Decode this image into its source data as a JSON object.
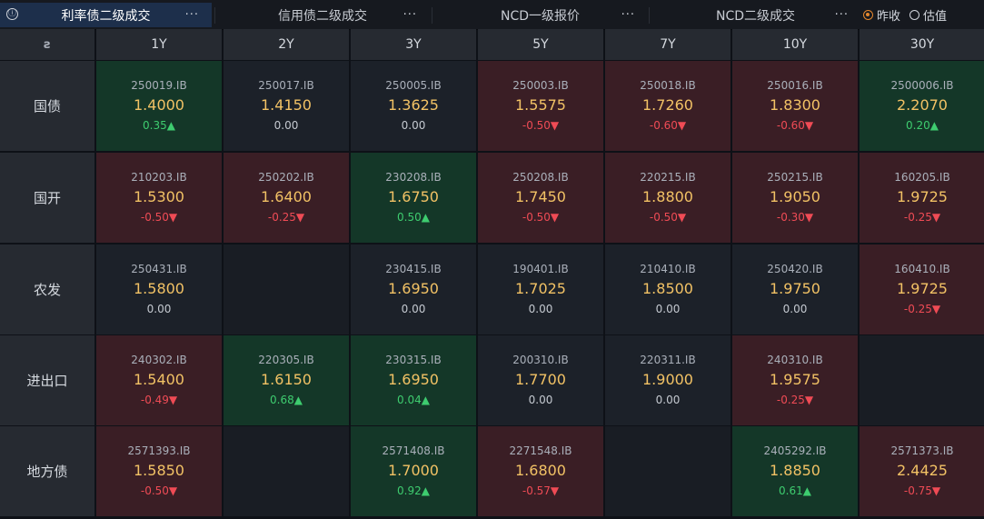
{
  "tabs": [
    {
      "label": "利率债二级成交",
      "active": true,
      "menu": "···"
    },
    {
      "label": "信用债二级成交",
      "active": false,
      "menu": "···"
    },
    {
      "label": "NCD一级报价",
      "active": false,
      "menu": "···"
    },
    {
      "label": "NCD二级成交",
      "active": false,
      "menu": "···"
    }
  ],
  "info_icon": "ⓘ",
  "price_mode": {
    "options": [
      {
        "label": "昨收",
        "selected": true
      },
      {
        "label": "估值",
        "selected": false
      }
    ]
  },
  "table": {
    "corner_icon": "ƨ",
    "columns": [
      "1Y",
      "2Y",
      "3Y",
      "5Y",
      "7Y",
      "10Y",
      "30Y"
    ],
    "rows": [
      {
        "label": "国债",
        "cells": [
          {
            "code": "250019.IB",
            "price": "1.4000",
            "change": "0.35",
            "dir": "up"
          },
          {
            "code": "250017.IB",
            "price": "1.4150",
            "change": "0.00",
            "dir": "flat"
          },
          {
            "code": "250005.IB",
            "price": "1.3625",
            "change": "0.00",
            "dir": "flat"
          },
          {
            "code": "250003.IB",
            "price": "1.5575",
            "change": "-0.50",
            "dir": "down"
          },
          {
            "code": "250018.IB",
            "price": "1.7260",
            "change": "-0.60",
            "dir": "down"
          },
          {
            "code": "250016.IB",
            "price": "1.8300",
            "change": "-0.60",
            "dir": "down"
          },
          {
            "code": "2500006.IB",
            "price": "2.2070",
            "change": "0.20",
            "dir": "up"
          }
        ]
      },
      {
        "label": "国开",
        "cells": [
          {
            "code": "210203.IB",
            "price": "1.5300",
            "change": "-0.50",
            "dir": "down"
          },
          {
            "code": "250202.IB",
            "price": "1.6400",
            "change": "-0.25",
            "dir": "down"
          },
          {
            "code": "230208.IB",
            "price": "1.6750",
            "change": "0.50",
            "dir": "up"
          },
          {
            "code": "250208.IB",
            "price": "1.7450",
            "change": "-0.50",
            "dir": "down"
          },
          {
            "code": "220215.IB",
            "price": "1.8800",
            "change": "-0.50",
            "dir": "down"
          },
          {
            "code": "250215.IB",
            "price": "1.9050",
            "change": "-0.30",
            "dir": "down"
          },
          {
            "code": "160205.IB",
            "price": "1.9725",
            "change": "-0.25",
            "dir": "down"
          }
        ]
      },
      {
        "label": "农发",
        "cells": [
          {
            "code": "250431.IB",
            "price": "1.5800",
            "change": "0.00",
            "dir": "flat"
          },
          null,
          {
            "code": "230415.IB",
            "price": "1.6950",
            "change": "0.00",
            "dir": "flat"
          },
          {
            "code": "190401.IB",
            "price": "1.7025",
            "change": "0.00",
            "dir": "flat"
          },
          {
            "code": "210410.IB",
            "price": "1.8500",
            "change": "0.00",
            "dir": "flat"
          },
          {
            "code": "250420.IB",
            "price": "1.9750",
            "change": "0.00",
            "dir": "flat"
          },
          {
            "code": "160410.IB",
            "price": "1.9725",
            "change": "-0.25",
            "dir": "down"
          }
        ]
      },
      {
        "label": "进出口",
        "cells": [
          {
            "code": "240302.IB",
            "price": "1.5400",
            "change": "-0.49",
            "dir": "down"
          },
          {
            "code": "220305.IB",
            "price": "1.6150",
            "change": "0.68",
            "dir": "up"
          },
          {
            "code": "230315.IB",
            "price": "1.6950",
            "change": "0.04",
            "dir": "up"
          },
          {
            "code": "200310.IB",
            "price": "1.7700",
            "change": "0.00",
            "dir": "flat"
          },
          {
            "code": "220311.IB",
            "price": "1.9000",
            "change": "0.00",
            "dir": "flat"
          },
          {
            "code": "240310.IB",
            "price": "1.9575",
            "change": "-0.25",
            "dir": "down"
          },
          null
        ]
      },
      {
        "label": "地方债",
        "cells": [
          {
            "code": "2571393.IB",
            "price": "1.5850",
            "change": "-0.50",
            "dir": "down"
          },
          null,
          {
            "code": "2571408.IB",
            "price": "1.7000",
            "change": "0.92",
            "dir": "up"
          },
          {
            "code": "2271548.IB",
            "price": "1.6800",
            "change": "-0.57",
            "dir": "down"
          },
          null,
          {
            "code": "2405292.IB",
            "price": "1.8850",
            "change": "0.61",
            "dir": "up"
          },
          {
            "code": "2571373.IB",
            "price": "2.4425",
            "change": "-0.75",
            "dir": "down"
          }
        ]
      }
    ]
  },
  "arrows": {
    "up": "▲",
    "down": "▼"
  },
  "colors": {
    "up_bg": "#143728",
    "down_bg": "#3a1e25",
    "neutral_bg": "#1c2129",
    "price": "#f2c265",
    "up_text": "#3ecc6f",
    "down_text": "#ef4b55",
    "active_tab": "#1d2f4b",
    "radio_accent": "#e4872e"
  }
}
